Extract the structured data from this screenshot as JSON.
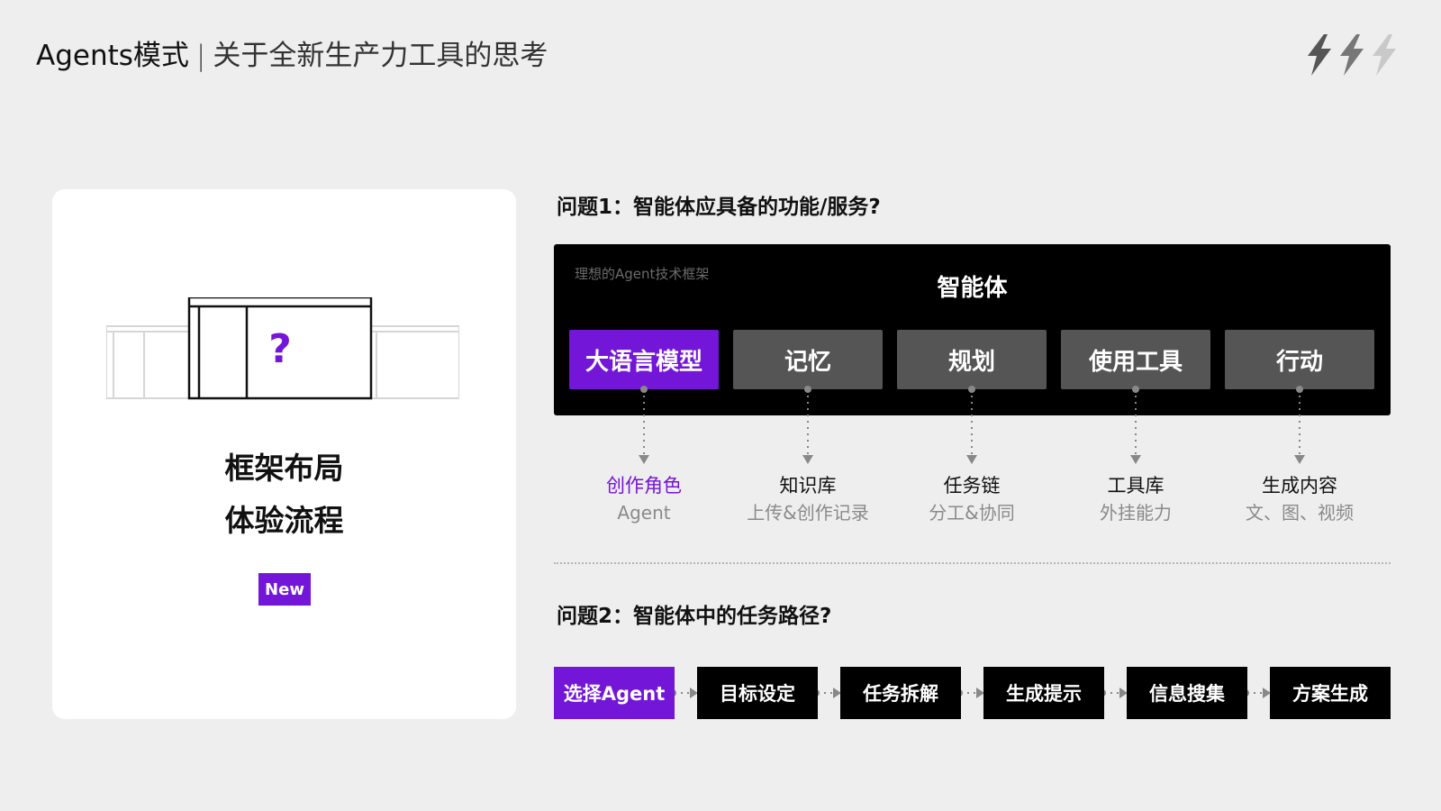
{
  "header": {
    "title_main": "Agents模式",
    "title_separator": "|",
    "title_sub": "关于全新生产力工具的思考"
  },
  "logo": {
    "icon": "lightning-bolts-icon",
    "colors": [
      "#555555",
      "#777777",
      "#c9c9c9"
    ]
  },
  "left_card": {
    "illustration_icon": "question-mark-layout-icon",
    "question_mark": "?",
    "lines": [
      "框架布局",
      "体验流程"
    ],
    "badge": "New"
  },
  "question1": {
    "title": "问题1：智能体应具备的功能/服务?",
    "panel": {
      "caption": "理想的Agent技术框架",
      "title": "智能体",
      "modules": [
        {
          "label": "大语言模型",
          "active": true
        },
        {
          "label": "记忆",
          "active": false
        },
        {
          "label": "规划",
          "active": false
        },
        {
          "label": "使用工具",
          "active": false
        },
        {
          "label": "行动",
          "active": false
        }
      ]
    },
    "resources": [
      {
        "label": "创作角色",
        "desc": "Agent",
        "accent": true
      },
      {
        "label": "知识库",
        "desc": "上传&创作记录",
        "accent": false
      },
      {
        "label": "任务链",
        "desc": "分工&协同",
        "accent": false
      },
      {
        "label": "工具库",
        "desc": "外挂能力",
        "accent": false
      },
      {
        "label": "生成内容",
        "desc": "文、图、视频",
        "accent": false
      }
    ]
  },
  "question2": {
    "title": "问题2：智能体中的任务路径?",
    "steps": [
      {
        "label": "选择Agent",
        "active": true
      },
      {
        "label": "目标设定",
        "active": false
      },
      {
        "label": "任务拆解",
        "active": false
      },
      {
        "label": "生成提示",
        "active": false
      },
      {
        "label": "信息搜集",
        "active": false
      },
      {
        "label": "方案生成",
        "active": false
      }
    ]
  },
  "colors": {
    "accent": "#7416d8",
    "background": "#eeeeee",
    "panel": "#000000",
    "module": "#555555",
    "muted_text": "#8a8a8a"
  }
}
